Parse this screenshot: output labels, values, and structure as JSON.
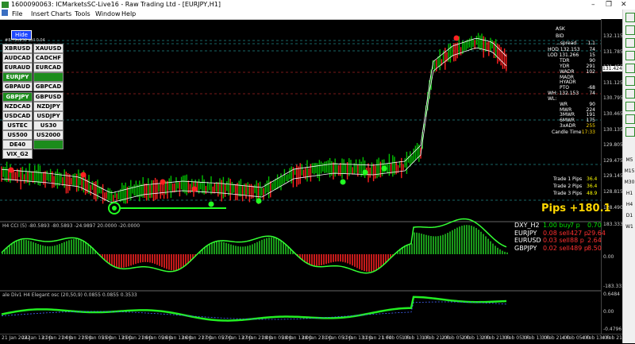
{
  "window": {
    "title": "1600090063: ICMarketsSC-Live16 - Raw Trading Ltd - [EURJPY,H1]",
    "minimize": "–",
    "restore": "❐",
    "close": "✕"
  },
  "menu": [
    "File",
    "Insert",
    "Charts",
    "Tools",
    "Window",
    "Help"
  ],
  "chart": {
    "hide_button": "Hide",
    "small_header": "#8.75e958 sell 0.04",
    "price_axis": [
      "132.115",
      "131.785",
      "131.455",
      "131.125",
      "130.795",
      "130.465",
      "130.135",
      "129.805",
      "129.475",
      "129.145",
      "128.815",
      "128.490"
    ],
    "current_price": "131.424",
    "cci_axis": [
      "183.3333",
      "0.00",
      "-183.3333"
    ],
    "osc_axis": [
      "0.6484",
      "0.00",
      "-0.4796"
    ],
    "time_labels": [
      "21 Jan 2022",
      "24 Jan 13:00",
      "21 Jan 21:00",
      "24 Jan 21:00",
      "25 Jan 05:00",
      "25 Jan 13:00",
      "25 Jan 21:00",
      "26 Jan 05:00",
      "26 Jan 13:00",
      "26 Jan 21:00",
      "27 Jan 05:00",
      "27 Jan 13:00",
      "27 Jan 21:00",
      "28 Jan 05:00",
      "28 Jan 13:00",
      "28 Jan 21:00",
      "31 Jan 05:00",
      "31 Jan 13:00",
      "31 Jan 21:00",
      "1 Feb 05:00",
      "1 Feb 13:00",
      "1 Feb 21:00",
      "2 Feb 05:00",
      "2 Feb 13:00",
      "2 Feb 21:00",
      "3 Feb 05:00",
      "3 Feb 13:00",
      "3 Feb 21:00",
      "4 Feb 05:00",
      "4 Feb 13:00",
      "4 Feb 21:00"
    ]
  },
  "symbols": [
    [
      "XBRUSD",
      "XAUUSD"
    ],
    [
      "AUDCAD",
      "CADCHF"
    ],
    [
      "EURAUD",
      "EURCAD"
    ],
    [
      "EURJPY",
      "EURNZD"
    ],
    [
      "GBPAUD",
      "GBPCAD"
    ],
    [
      "GBPJPY",
      "GBPUSD"
    ],
    [
      "NZDCAD",
      "NZDJPY"
    ],
    [
      "USDCAD",
      "USDJPY"
    ],
    [
      "USTEC",
      "US30"
    ],
    [
      "US500",
      "US2000"
    ],
    [
      "DE40",
      "DXY_H2"
    ],
    [
      "VIX_G2",
      ""
    ]
  ],
  "active_symbols": [
    "EURJPY",
    "EURNZD",
    "GBPJPY",
    "DXY_H2"
  ],
  "stats": [
    {
      "label": "ASK",
      "value": ""
    },
    {
      "label": "BID",
      "value": ""
    },
    {
      "label": "...spread",
      "value": "1.1"
    },
    {
      "label": "HOD 132.153",
      "value": "74"
    },
    {
      "label": "LOD 131.266",
      "value": "15"
    },
    {
      "label": "TDR",
      "value": "90"
    },
    {
      "label": "YDR",
      "value": "291"
    },
    {
      "label": "WADR",
      "value": "102"
    },
    {
      "label": "MADR",
      "value": ""
    },
    {
      "label": "HYADR",
      "value": ""
    },
    {
      "label": "PTO",
      "value": "-68"
    },
    {
      "label": "WH: 132.153",
      "value": "74"
    },
    {
      "label": "WL:",
      "value": ""
    },
    {
      "label": "WR",
      "value": "90"
    },
    {
      "label": "MWR",
      "value": "224"
    },
    {
      "label": "3MWR",
      "value": "191"
    },
    {
      "label": "6MWR",
      "value": "175"
    },
    {
      "label": "3xADR",
      "value": "255"
    },
    {
      "label": "Candle Time",
      "value": "17:33"
    }
  ],
  "trade_pips": [
    {
      "label": "Trade 1 Pips",
      "value": "36.4"
    },
    {
      "label": "Trade 2 Pips",
      "value": "36.4"
    },
    {
      "label": "Trade 3 Pips",
      "value": "48.9"
    }
  ],
  "pips_total": "Pips +180.1",
  "cci_title": "H4 CCI (5) -80.5893 -80.5893 -24.9897 20.0000 -20.0000",
  "positions": [
    {
      "sym": "DXY_H2",
      "info": "1.00 buy",
      "p": "7 p",
      "v": "0.70",
      "color": "#00e000"
    },
    {
      "sym": "EURJPY",
      "info": "0.08 sell",
      "p": "427 p",
      "v": "29.64",
      "color": "#ff3030"
    },
    {
      "sym": "EURUSD",
      "info": "0.03 sell",
      "p": "88 p",
      "v": "2.64",
      "color": "#ff3030"
    },
    {
      "sym": "GBPJPY",
      "info": "0.02 sell",
      "p": "489 p",
      "v": "8.50",
      "color": "#ff3030"
    }
  ],
  "osc_title": "ale Div1 H4 Elegant osc (20,50,9) 0.0855 0.0855 0.3533",
  "colors": {
    "up": "#00c000",
    "down": "#ff2020",
    "band": "#ffffff",
    "accent": "#ffd700"
  }
}
